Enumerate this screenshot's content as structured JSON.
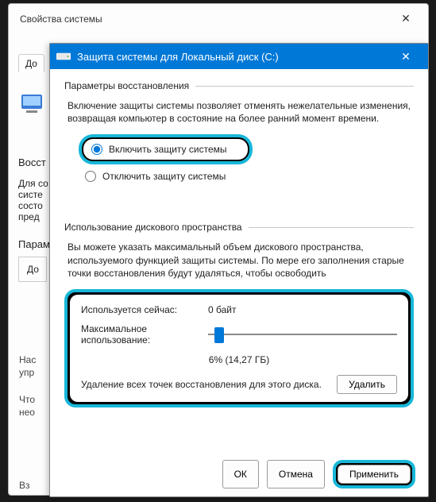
{
  "outer": {
    "title": "Свойства системы",
    "tab": "До",
    "restore_heading": "Восст",
    "snippet1": "Для со",
    "snippet2": "систе",
    "snippet3": "состо",
    "snippet4": "пред",
    "params_heading": "Парам",
    "params_tab": "До",
    "nas": "Нас",
    "upr": "упр",
    "chto": "Что",
    "neo": "нео",
    "vz": "Вз"
  },
  "dialog": {
    "title": "Защита системы для Локальный диск (C:)",
    "close_glyph": "✕"
  },
  "restore": {
    "group_label": "Параметры восстановления",
    "description": "Включение защиты системы позволяет отменять нежелательные изменения, возвращая компьютер в состояние на более ранний момент времени.",
    "enable_label": "Включить защиту системы",
    "disable_label": "Отключить защиту системы"
  },
  "usage": {
    "group_label": "Использование дискового пространства",
    "description": "Вы можете указать максимальный объем дискового пространства, используемого функцией защиты системы. По мере его заполнения старые точки восстановления будут удаляться, чтобы освободить",
    "current_label": "Используется сейчас:",
    "current_value": "0 байт",
    "max_label": "Максимальное использование:",
    "percent_text": "6% (14,27 ГБ)",
    "slider_position_pct": 6,
    "delete_text": "Удаление всех точек восстановления для этого диска.",
    "delete_button": "Удалить"
  },
  "buttons": {
    "ok": "ОК",
    "cancel": "Отмена",
    "apply": "Применить"
  }
}
